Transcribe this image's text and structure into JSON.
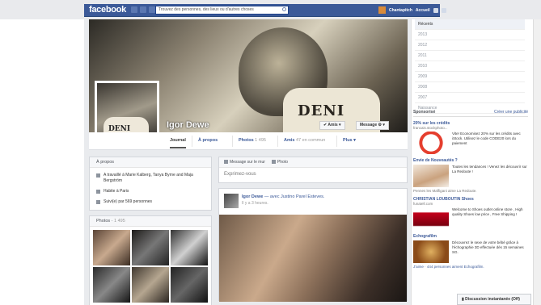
{
  "topbar": {
    "logo": "facebook",
    "search_placeholder": "Trouvez des personnes, des lieux ou d'autres choses",
    "user_name": "Chantapitch",
    "home_label": "Accueil"
  },
  "profile": {
    "name": "Igor Dewe",
    "shirt_text": "DENI",
    "friends_button": "✔ Amis ▾",
    "message_button": "Message ⚙ ▾"
  },
  "tabs": [
    {
      "label": "Journal",
      "count": ""
    },
    {
      "label": "À propos",
      "count": ""
    },
    {
      "label": "Photos",
      "count": "1 495"
    },
    {
      "label": "Amis",
      "count": "47 en commun"
    },
    {
      "label": "Plus ▾",
      "count": ""
    }
  ],
  "about": {
    "title": "À propos",
    "items": [
      "A travaillé à Marie Kalberg, Tanya Byrne and Maja Bergström",
      "Habite à Paris",
      "Suivi(e) par 569 personnes"
    ]
  },
  "photos_box": {
    "title": "Photos",
    "count": "1 495"
  },
  "composer": {
    "tab_status": "Message sur le mur",
    "tab_photo": "Photo",
    "placeholder": "Exprimez-vous"
  },
  "post": {
    "author": "Igor Dewe",
    "with_text": "— avec Justino Parel Esteves.",
    "time": "Il y a 3 heures."
  },
  "timeline_nav": [
    "Récents",
    "2013",
    "2012",
    "2011",
    "2010",
    "2009",
    "2008",
    "2007",
    "Naissance"
  ],
  "ads": {
    "title": "Sponsorisé",
    "create_link": "Créer une publicité",
    "items": [
      {
        "title": "20% sur les crédits",
        "sub": "francais.stockphoto...",
        "text": "Vite! Economisez 20% sur les crédits avec iStock. Utilisez le code CODE20 lors du paiement",
        "like": ""
      },
      {
        "title": "Envie de Nouveautés ?",
        "sub": "",
        "text": "Toutes les tendances ! Venez les découvrir sur La Redoute !",
        "like": "Pennes les Maffigani aime La Redoute."
      },
      {
        "title": "CHRISTIAN LOUBOUTIN Shoes",
        "sub": "funatell.com",
        "text": "Welcome to Shoes outlet online store , High quality Shoes low price , Free Shipping !",
        "like": ""
      },
      {
        "title": "Echografilm",
        "sub": "",
        "text": "Découvrez le sexe de votre bébé grâce à l'échographie 3D effectuée dès 15 semaines SG.",
        "like": "J'aime · 444 personnes aiment Echografilm."
      }
    ]
  },
  "chat": {
    "label": "Discussion instantanée (Off)"
  },
  "colors": {
    "brand": "#3b5998",
    "background": "#e9ebee"
  }
}
